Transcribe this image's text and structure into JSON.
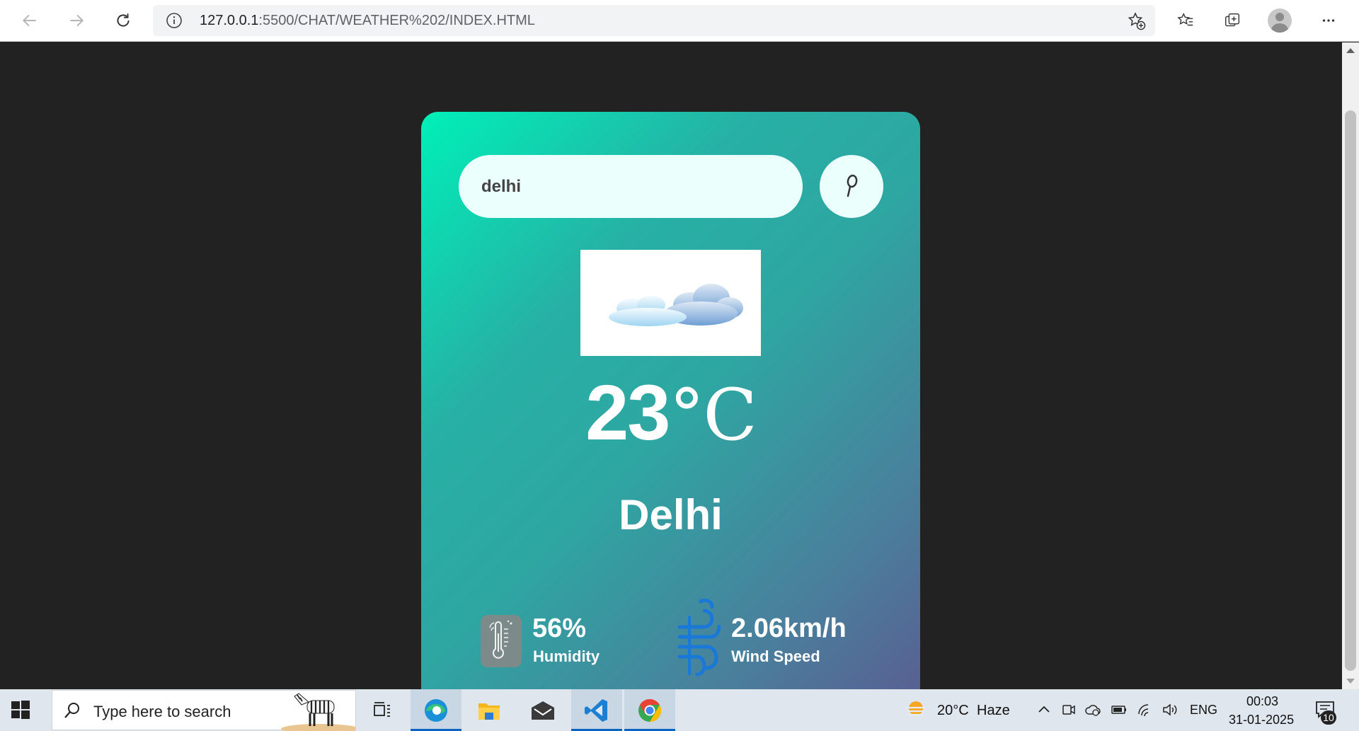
{
  "browser": {
    "url_host": "127.0.0.1",
    "url_path": ":5500/CHAT/WEATHER%202/INDEX.HTML"
  },
  "weather": {
    "search_value": "delhi",
    "temperature_value": "23",
    "temperature_unit": "°C",
    "city": "Delhi",
    "humidity_value": "56%",
    "humidity_label": "Humidity",
    "wind_value": "2.06km/h",
    "wind_label": "Wind Speed"
  },
  "taskbar": {
    "search_placeholder": "Type here to search",
    "weather_temp": "20°C",
    "weather_desc": "Haze",
    "language": "ENG",
    "time": "00:03",
    "date": "31-01-2025",
    "notification_count": "10"
  },
  "colors": {
    "card_gradient_start": "#00f0b8",
    "card_gradient_end": "#5b5a91",
    "page_background": "#222222",
    "search_field": "#ebfffc"
  }
}
